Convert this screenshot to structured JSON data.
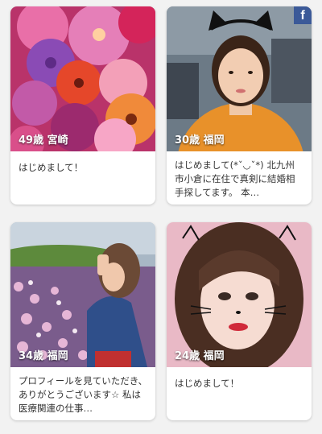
{
  "cards": [
    {
      "age_location": "49歳 宮崎",
      "message": "はじめまして！",
      "photo": "flower-bouquet-photo"
    },
    {
      "age_location": "30歳 福岡",
      "message": "はじめまして(*ˇ◡ˇ*) 北九州市小倉に在住で真剣に結婚相手探してます。 本…",
      "photo": "woman-with-cat-ears-photo",
      "badge": "f"
    },
    {
      "age_location": "34歳 福岡",
      "message": "プロフィールを見ていただき、ありがとうございます☆ 私は医療関連の仕事…",
      "photo": "woman-in-flower-field-photo"
    },
    {
      "age_location": "24歳 福岡",
      "message": "はじめまして！",
      "photo": "woman-with-cat-filter-photo"
    }
  ],
  "colors": {
    "background": "#f2f2f2",
    "card": "#ffffff",
    "text": "#333333",
    "facebook": "#3b5998"
  }
}
